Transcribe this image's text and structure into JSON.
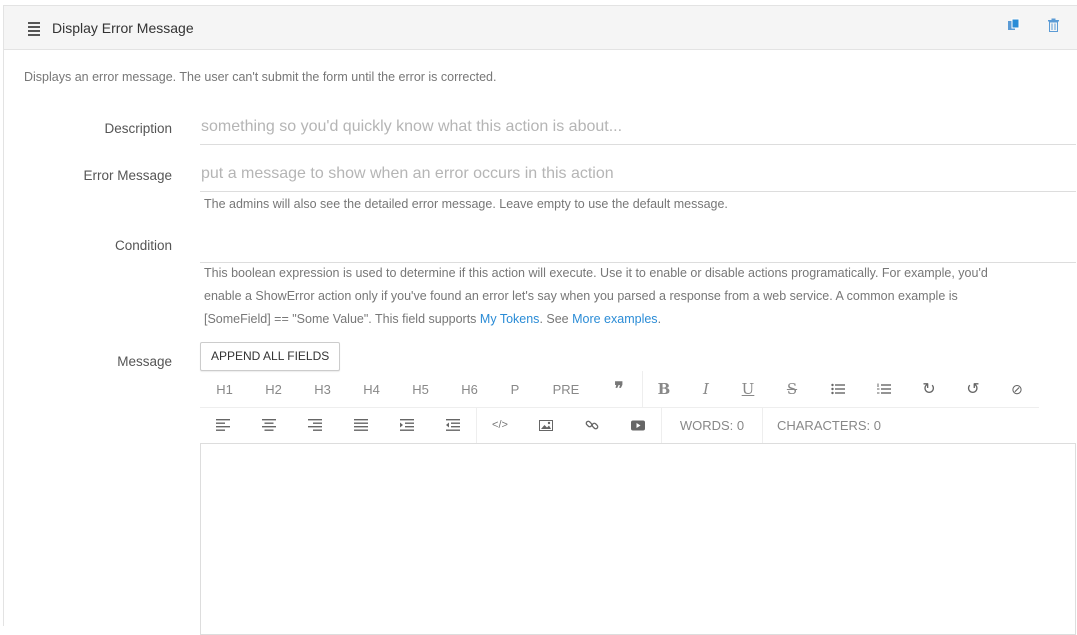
{
  "header": {
    "title": "Display Error Message",
    "icons": {
      "menu": "hamburger-icon",
      "copy": "copy-icon",
      "delete": "trash-icon"
    },
    "accent_color": "#2b8cd6"
  },
  "description_text": "Displays an error message. The user can't submit the form until the error is corrected.",
  "fields": {
    "description": {
      "label": "Description",
      "placeholder": "something so you'd quickly know what this action is about...",
      "value": ""
    },
    "error_message": {
      "label": "Error Message",
      "placeholder": "put a message to show when an error occurs in this action",
      "value": "",
      "help": "The admins will also see the detailed error message. Leave empty to use the default message."
    },
    "condition": {
      "label": "Condition",
      "value": "",
      "help_line1": "This boolean expression is used to determine if this action will execute. Use it to enable or disable actions programatically. For example, you'd",
      "help_line2": "enable a ShowError action only if you've found an error let's say when you parsed a response from a web service. A common example is",
      "help_line3_prefix": "[SomeField] == \"Some Value\". This field supports ",
      "link_tokens": "My Tokens",
      "help_line3_mid": ". See ",
      "link_examples": "More examples",
      "help_line3_suffix": "."
    },
    "message": {
      "label": "Message",
      "append_button": "APPEND ALL FIELDS"
    }
  },
  "toolbar": {
    "row1": [
      "H1",
      "H2",
      "H3",
      "H4",
      "H5",
      "H6",
      "P",
      "PRE"
    ],
    "row1_icons": [
      "blockquote-icon",
      "bold-icon",
      "italic-icon",
      "underline-icon",
      "strikethrough-icon",
      "bullet-list-icon",
      "numbered-list-icon",
      "redo-icon",
      "undo-icon",
      "clear-format-icon"
    ],
    "row2_icons": [
      "align-left-icon",
      "align-center-icon",
      "align-right-icon",
      "align-justify-icon",
      "indent-icon",
      "outdent-icon",
      "code-icon",
      "image-icon",
      "link-icon",
      "video-icon"
    ],
    "words": "WORDS: 0",
    "characters": "CHARACTERS: 0"
  }
}
